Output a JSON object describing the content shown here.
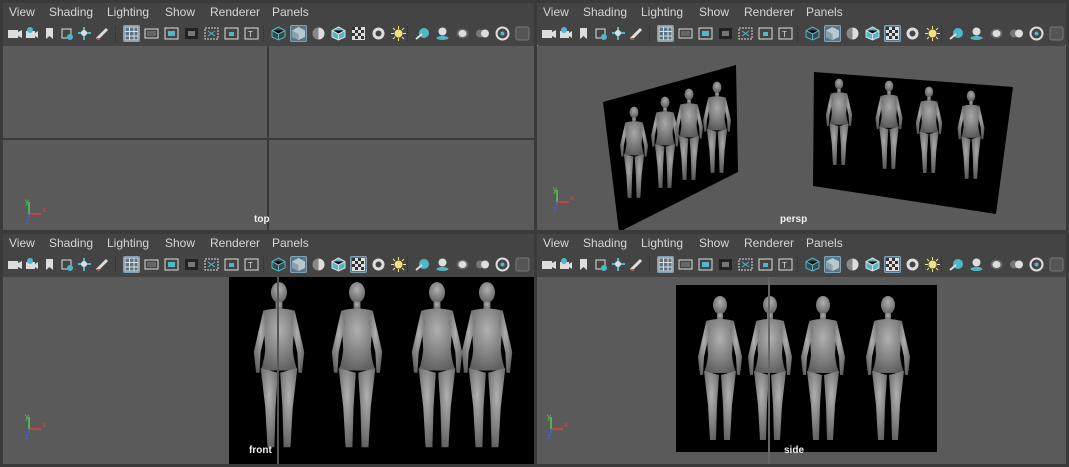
{
  "menus": [
    "View",
    "Shading",
    "Lighting",
    "Show",
    "Renderer",
    "Panels"
  ],
  "colors": {
    "viewport_bg": "#5a5a5a",
    "panel_bg": "#444444",
    "active_border": "#8fa0b2",
    "tool_active": "#5c7585",
    "icon_teal": "#4fb8c8",
    "axis_x": "#e04040",
    "axis_y": "#50d050",
    "axis_z": "#4060ff"
  },
  "toolbar_icons": [
    "select-camera-icon",
    "camera-attributes-icon",
    "bookmark-icon",
    "image-plane-icon",
    "two-d-pan-zoom-icon",
    "grease-pencil-icon",
    "grid-icon",
    "film-gate-icon",
    "resolution-gate-icon",
    "gate-mask-icon",
    "field-chart-icon",
    "safe-action-icon",
    "safe-title-icon",
    "wireframe-icon",
    "smooth-shade-icon",
    "use-default-material-icon",
    "wireframe-on-shaded-icon",
    "xray-icon",
    "xray-active-components-icon",
    "xray-joints-icon",
    "use-all-lights-icon",
    "shadows-icon",
    "screen-space-ao-icon",
    "motion-blur-icon",
    "multisample-aa-icon",
    "depth-of-field-icon",
    "isolate-select-icon"
  ],
  "panels": {
    "top": {
      "label": "top"
    },
    "persp": {
      "label": "persp"
    },
    "front": {
      "label": "front"
    },
    "side": {
      "label": "side"
    }
  },
  "axis_labels": {
    "x": "x",
    "y": "y",
    "z": "z"
  }
}
